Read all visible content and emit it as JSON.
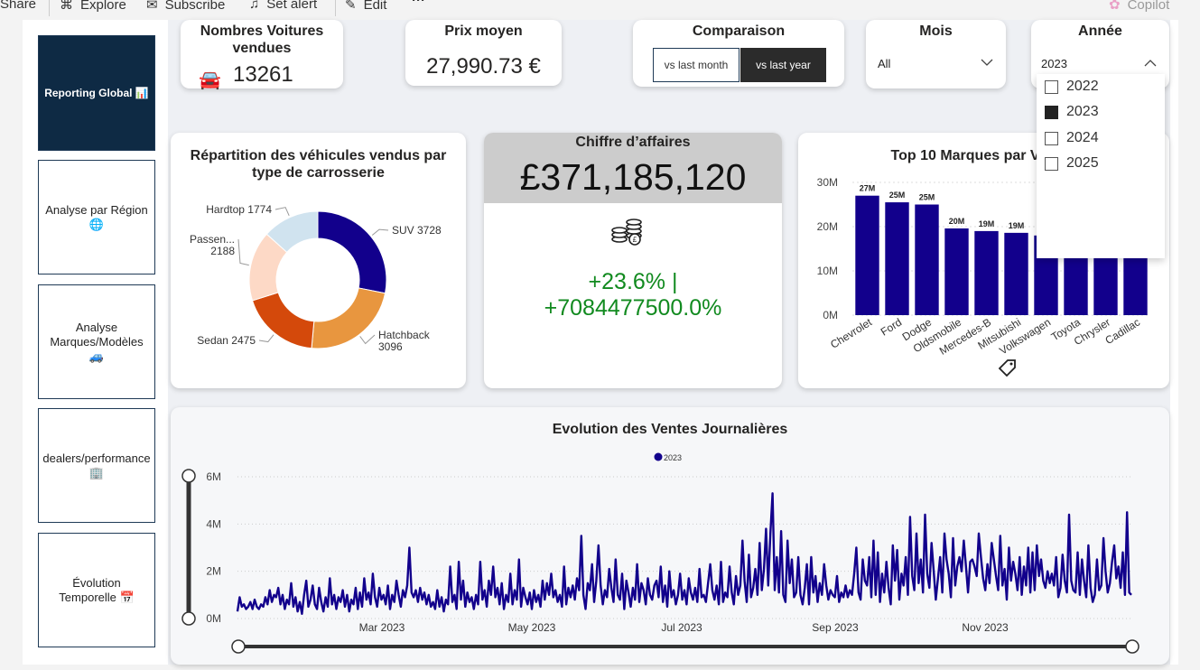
{
  "toolbar": {
    "share": "Share",
    "explore": "Explore",
    "subscribe": "Subscribe",
    "set_alert": "Set alert",
    "edit": "Edit",
    "more": "···",
    "copilot": "Copilot"
  },
  "nav": {
    "items": [
      {
        "label": "Reporting Global 📊"
      },
      {
        "label": "Analyse par Région 🌐"
      },
      {
        "label": "Analyse Marques/Modèles 🚙"
      },
      {
        "label": "dealers/performance 🏢"
      },
      {
        "label": "Évolution Temporelle 📅"
      }
    ]
  },
  "kpi_cars": {
    "title": "Nombres Voitures vendues",
    "value": "13261"
  },
  "kpi_price": {
    "title": "Prix moyen",
    "value": "27,990.73 €"
  },
  "comparison": {
    "title": "Comparaison",
    "btn_month": "vs last month",
    "btn_year": "vs last year",
    "selected": "vs last year"
  },
  "month_slicer": {
    "title": "Mois",
    "value": "All"
  },
  "year_slicer": {
    "title": "Année",
    "value": "2023",
    "options": [
      "2022",
      "2023",
      "2024",
      "2025"
    ],
    "checked": "2023"
  },
  "revenue": {
    "title": "Chiffre d’affaires",
    "value": "£371,185,120",
    "change_line1": "+23.6% |",
    "change_line2": "+7084477500.0%",
    "change_color": "#118a1f"
  },
  "colors": {
    "navy": "#12008c",
    "nav_active": "#0e2a44",
    "grey_header": "#cccccc"
  },
  "chart_data": [
    {
      "type": "pie",
      "title": "Répartition des véhicules vendus par type de carrosserie",
      "categories": [
        "SUV",
        "Hatchback",
        "Sedan",
        "Passen...",
        "Hardtop"
      ],
      "values": [
        3728,
        3096,
        2475,
        2188,
        1774
      ],
      "colors": [
        "#12008c",
        "#e8963f",
        "#d4490b",
        "#fdd9c6",
        "#d0e3ef"
      ],
      "labels": [
        "SUV 3728",
        "Hatchback 3096",
        "Sedan 2475",
        "Passen... 2188",
        "Hardtop 1774"
      ]
    },
    {
      "type": "bar",
      "title": "Top 10 Marques par Ventes",
      "categories": [
        "Chevrolet",
        "Ford",
        "Dodge",
        "Oldsmobile",
        "Mercedes-B",
        "Mitsubishi",
        "Volkswagen",
        "Toyota",
        "Chrysler",
        "Cadillac"
      ],
      "values": [
        27,
        25.5,
        25,
        19.6,
        19,
        18.6,
        18,
        17.5,
        17.2,
        17
      ],
      "data_labels": [
        "27M",
        "25M",
        "25M",
        "20M",
        "19M",
        "19M",
        "",
        "",
        "",
        ""
      ],
      "yticks": [
        "0M",
        "10M",
        "20M",
        "30M"
      ],
      "ylim": [
        0,
        30
      ],
      "color": "#12008c"
    },
    {
      "type": "line",
      "title": "Evolution des Ventes Journalières",
      "legend": "2023",
      "yticks": [
        "0M",
        "2M",
        "4M",
        "6M"
      ],
      "ylim": [
        0,
        6
      ],
      "xticks": [
        "Mar 2023",
        "May 2023",
        "Jul 2023",
        "Sep 2023",
        "Nov 2023"
      ],
      "color": "#12008c",
      "values": [
        0.3,
        0.9,
        0.5,
        0.6,
        0.4,
        0.5,
        0.7,
        0.4,
        0.8,
        0.5,
        0.4,
        0.6,
        0.5,
        0.9,
        0.6,
        1.2,
        0.7,
        1.0,
        0.9,
        1.3,
        0.6,
        1.0,
        0.4,
        0.8,
        0.6,
        1.5,
        0.5,
        0.9,
        0.3,
        0.7,
        0.2,
        1.0,
        1.6,
        0.5,
        0.8,
        1.4,
        0.6,
        0.4,
        1.3,
        0.7,
        0.3,
        0.9,
        0.5,
        1.7,
        0.6,
        1.0,
        0.4,
        0.9,
        0.7,
        1.2,
        0.5,
        1.0,
        0.3,
        0.8,
        0.6,
        1.3,
        0.4,
        1.1,
        0.5,
        1.7,
        0.8,
        1.1,
        0.6,
        1.9,
        0.9,
        0.5,
        1.3,
        0.8,
        1.0,
        0.6,
        1.4,
        0.4,
        1.0,
        0.7,
        1.6,
        1.0,
        0.5,
        1.2,
        0.9,
        1.4,
        3.0,
        1.1,
        0.9,
        1.2,
        0.7,
        1.3,
        0.8,
        1.1,
        0.6,
        1.0,
        0.5,
        0.7,
        0.4,
        1.2,
        0.5,
        0.9,
        0.3,
        0.8,
        0.6,
        2.2,
        0.7,
        1.0,
        0.4,
        2.4,
        0.8,
        1.6,
        0.5,
        1.1,
        0.7,
        0.9,
        0.4,
        1.0,
        0.6,
        2.4,
        0.8,
        1.2,
        0.5,
        1.6,
        1.0,
        2.2,
        0.9,
        1.3,
        0.6,
        1.5,
        0.4,
        1.0,
        0.7,
        1.9,
        0.6,
        1.2,
        0.8,
        2.5,
        0.5,
        1.3,
        0.9,
        0.6,
        1.1,
        0.4,
        1.2,
        0.7,
        1.0,
        0.5,
        1.6,
        0.8,
        1.5,
        1.0,
        1.9,
        0.9,
        1.2,
        0.7,
        1.0,
        0.5,
        2.2,
        0.6,
        1.3,
        0.9,
        1.4,
        0.8,
        1.7,
        1.2,
        3.5,
        1.0,
        0.4,
        1.5,
        1.2,
        2.3,
        0.7,
        1.6,
        3.1,
        1.4,
        0.6,
        1.2,
        0.9,
        2.1,
        1.3,
        0.7,
        2.5,
        1.0,
        0.8,
        1.9,
        0.4,
        1.6,
        1.1,
        0.5,
        1.3,
        0.8,
        2.3,
        0.7,
        1.5,
        1.2,
        0.6,
        1.7,
        1.0,
        0.8,
        1.4,
        1.6,
        0.9,
        2.2,
        0.7,
        1.4,
        0.5,
        2.0,
        0.9,
        1.2,
        0.6,
        1.0,
        1.9,
        0.8,
        1.2,
        0.6,
        1.7,
        1.1,
        0.8,
        1.3,
        0.7,
        2.1,
        0.9,
        1.0,
        0.7,
        1.5,
        2.3,
        1.2,
        0.8,
        1.4,
        0.6,
        2.4,
        0.7,
        1.1,
        0.9,
        2.2,
        1.1,
        0.6,
        1.8,
        1.0,
        1.4,
        3.3,
        1.6,
        0.7,
        2.7,
        0.9,
        1.3,
        2.1,
        1.0,
        3.2,
        1.2,
        2.1,
        3.8,
        1.4,
        3.6,
        5.3,
        1.2,
        2.6,
        1.1,
        3.7,
        1.0,
        0.7,
        3.3,
        1.5,
        2.5,
        0.9,
        1.1,
        2.6,
        1.0,
        0.6,
        1.3,
        2.3,
        0.6,
        2.6,
        1.1,
        1.8,
        0.7,
        1.5,
        1.0,
        2.3,
        1.4,
        0.8,
        1.2,
        1.0,
        0.9,
        1.8,
        0.7,
        1.1,
        0.9,
        1.4,
        0.9,
        1.2,
        1.0,
        1.9,
        3.0,
        1.1,
        0.8,
        2.5,
        1.6,
        1.4,
        2.6,
        0.9,
        3.3,
        1.0,
        2.8,
        0.7,
        1.9,
        1.1,
        2.4,
        1.3,
        0.6,
        3.1,
        1.6,
        2.9,
        0.8,
        1.9,
        1.4,
        2.6,
        1.0,
        4.3,
        1.8,
        1.2,
        3.6,
        1.5,
        2.5,
        1.1,
        4.4,
        1.9,
        1.3,
        3.2,
        2.0,
        0.8,
        1.7,
        2.6,
        1.1,
        3.6,
        2.5,
        1.9,
        0.9,
        3.4,
        1.4,
        2.2,
        2.6,
        2.0,
        3.3,
        2.2,
        1.1,
        2.4,
        2.5,
        2.2,
        1.8,
        3.6,
        2.6,
        1.7,
        1.2,
        2.3,
        1.5,
        3.2,
        2.5,
        1.8,
        1.2,
        3.5,
        1.4,
        2.1,
        0.8,
        3.0,
        1.6,
        2.4,
        1.9,
        1.2,
        2.6,
        1.0,
        2.2,
        1.4,
        3.0,
        1.1,
        2.8,
        1.2,
        3.1,
        1.8,
        2.5,
        1.6,
        1.3,
        2.0,
        1.5,
        1.9,
        1.4,
        2.6,
        0.9,
        1.3,
        2.7,
        1.6,
        1.1,
        4.4,
        1.6,
        1.2,
        1.1,
        2.8,
        1.0,
        2.5,
        1.6,
        0.9,
        3.1,
        1.3,
        0.7,
        1.0,
        2.5,
        1.2,
        1.4,
        3.4,
        2.0,
        1.1,
        1.5,
        2.4,
        3.1,
        1.7,
        2.2,
        1.3,
        2.8,
        1.0,
        4.5,
        1.1,
        1.0
      ]
    }
  ]
}
